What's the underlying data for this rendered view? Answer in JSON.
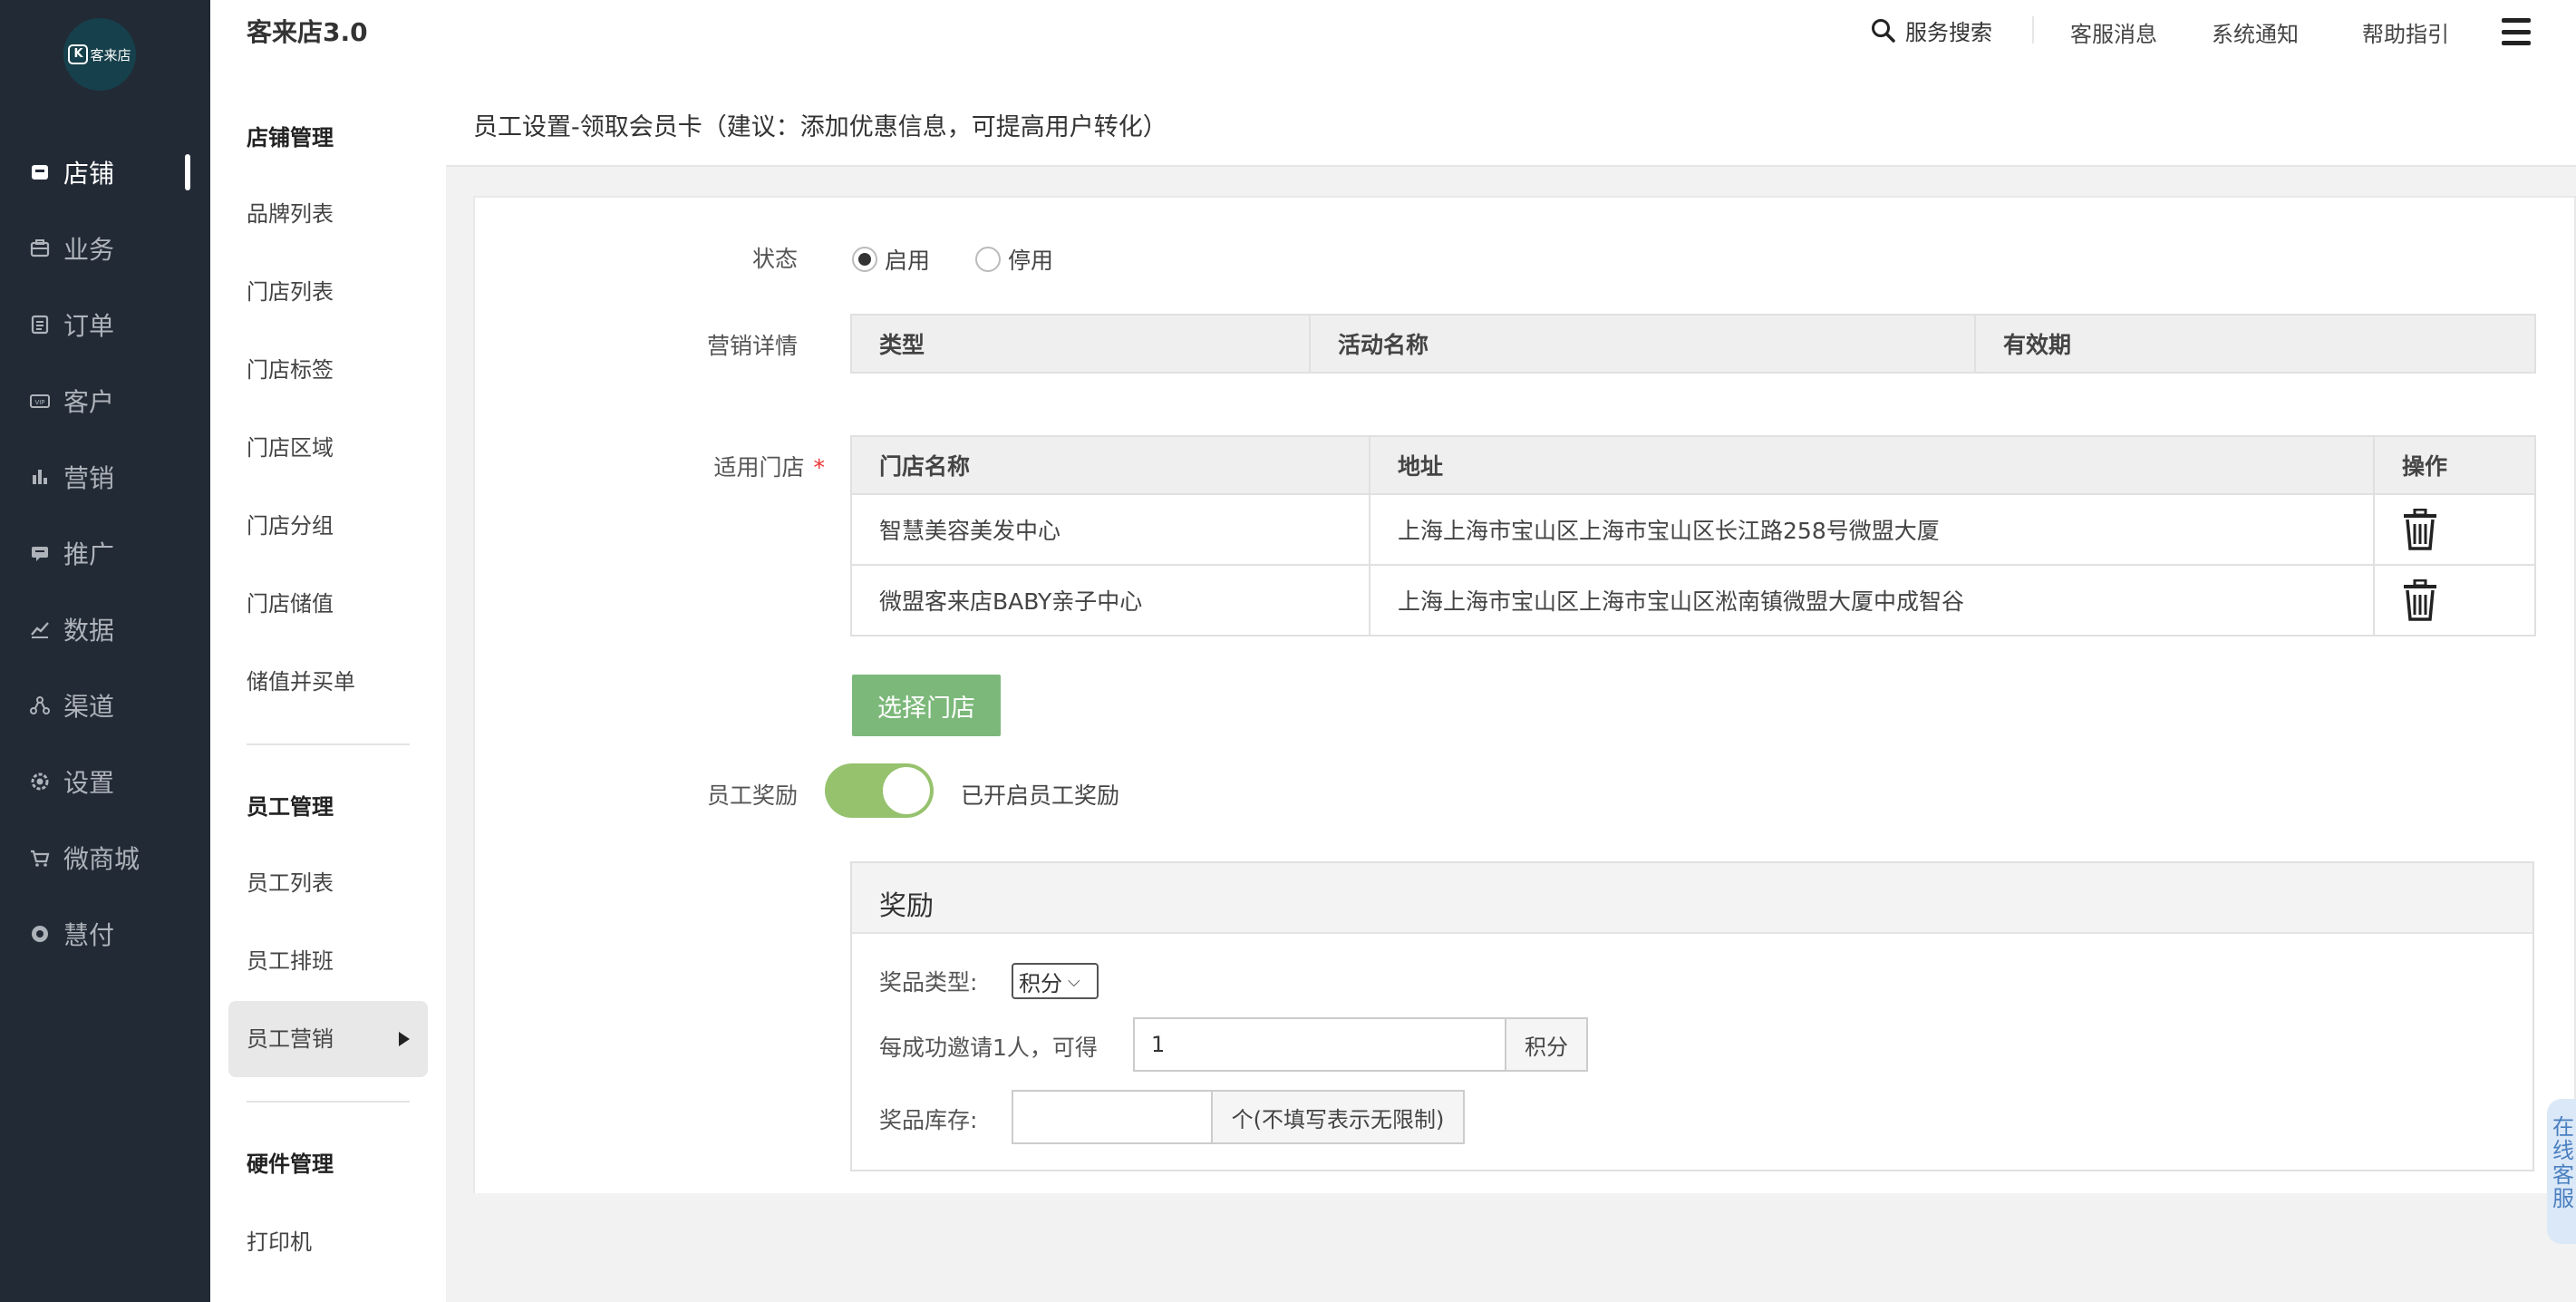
{
  "app": {
    "title": "客来店3.0",
    "logo_text": "客来店",
    "logo_letter": "K"
  },
  "header": {
    "search_label": "服务搜索",
    "links": [
      "客服消息",
      "系统通知",
      "帮助指引"
    ]
  },
  "nav": {
    "items": [
      {
        "label": "店铺",
        "icon": "store-icon"
      },
      {
        "label": "业务",
        "icon": "briefcase-icon"
      },
      {
        "label": "订单",
        "icon": "document-icon"
      },
      {
        "label": "客户",
        "icon": "vip-card-icon"
      },
      {
        "label": "营销",
        "icon": "bar-chart-icon"
      },
      {
        "label": "推广",
        "icon": "megaphone-icon"
      },
      {
        "label": "数据",
        "icon": "line-chart-icon"
      },
      {
        "label": "渠道",
        "icon": "channel-icon"
      },
      {
        "label": "设置",
        "icon": "gear-icon"
      },
      {
        "label": "微商城",
        "icon": "cart-icon"
      },
      {
        "label": "慧付",
        "icon": "pay-icon"
      }
    ],
    "active_index": 0
  },
  "subnav": {
    "groups": [
      {
        "title": "店铺管理",
        "items": [
          "品牌列表",
          "门店列表",
          "门店标签",
          "门店区域",
          "门店分组",
          "门店储值",
          "储值并买单"
        ]
      },
      {
        "title": "员工管理",
        "items": [
          "员工列表",
          "员工排班",
          "员工营销"
        ]
      },
      {
        "title": "硬件管理",
        "items": [
          "打印机"
        ]
      }
    ],
    "active_item": "员工营销"
  },
  "page": {
    "title": "员工设置-领取会员卡（建议：添加优惠信息，可提高用户转化）"
  },
  "form": {
    "status": {
      "label": "状态",
      "options": [
        "启用",
        "停用"
      ],
      "selected": "启用"
    },
    "marketing": {
      "label": "营销详情",
      "columns": [
        "类型",
        "活动名称",
        "有效期"
      ],
      "rows": []
    },
    "stores": {
      "label": "适用门店",
      "required_mark": "*",
      "columns": [
        "门店名称",
        "地址",
        "操作"
      ],
      "rows": [
        {
          "name": "智慧美容美发中心",
          "address": "上海上海市宝山区上海市宝山区长江路258号微盟大厦"
        },
        {
          "name": "微盟客来店BABY亲子中心",
          "address": "上海上海市宝山区上海市宝山区淞南镇微盟大厦中成智谷"
        }
      ],
      "select_button": "选择门店"
    },
    "reward_toggle": {
      "label": "员工奖励",
      "on": true,
      "status_text": "已开启员工奖励"
    },
    "reward": {
      "title": "奖励",
      "type_label": "奖品类型:",
      "type_value": "积分",
      "per_invite_label": "每成功邀请1人，可得",
      "per_invite_value": "1",
      "per_invite_unit": "积分",
      "stock_label": "奖品库存:",
      "stock_value": "",
      "stock_unit": "个(不填写表示无限制)"
    }
  },
  "side_tab": {
    "label": "在线客服"
  },
  "colors": {
    "nav_bg": "#222a36",
    "primary_green": "#7cb87a",
    "toggle_green": "#96c26e",
    "required": "#ee3333"
  }
}
